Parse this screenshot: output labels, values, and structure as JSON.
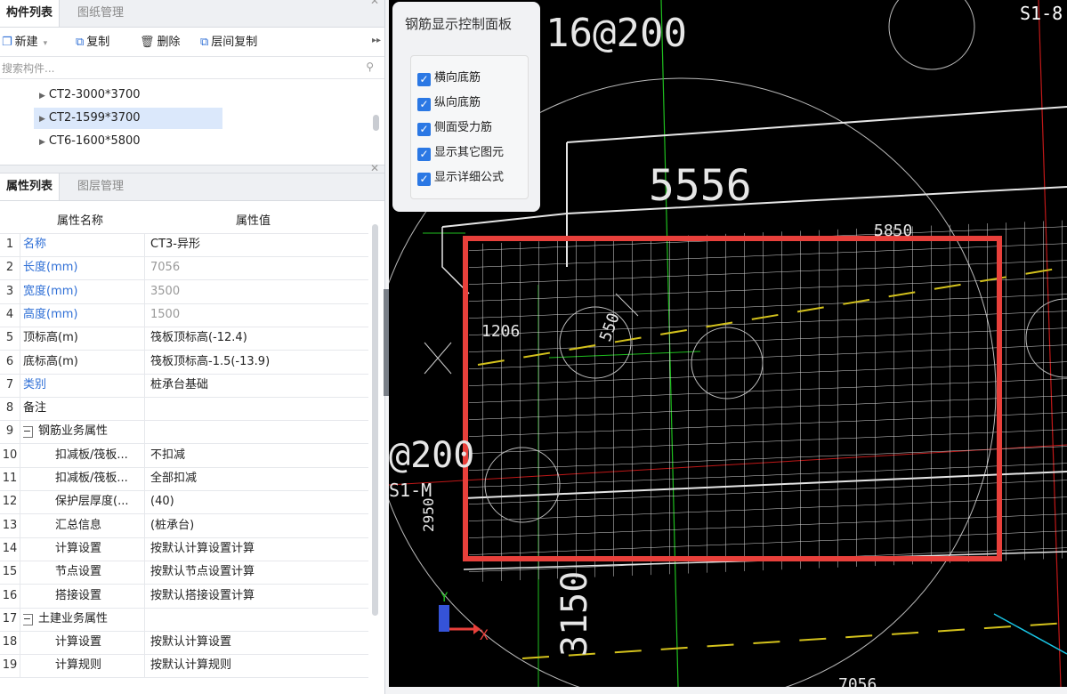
{
  "component_panel": {
    "tabs": [
      "构件列表",
      "图纸管理"
    ],
    "toolbar": {
      "new": "新建",
      "copy": "复制",
      "delete": "删除",
      "floor_copy": "层间复制"
    },
    "search_placeholder": "搜索构件...",
    "tree": [
      "CT2-3000*3700",
      "CT2-1599*3700",
      "CT6-1600*5800"
    ]
  },
  "property_panel": {
    "tabs": [
      "属性列表",
      "图层管理"
    ],
    "headers": {
      "name": "属性名称",
      "value": "属性值"
    },
    "rows": [
      {
        "n": "1",
        "name": "名称",
        "value": "CT3-异形"
      },
      {
        "n": "2",
        "name": "长度(mm)",
        "value": "7056"
      },
      {
        "n": "3",
        "name": "宽度(mm)",
        "value": "3500"
      },
      {
        "n": "4",
        "name": "高度(mm)",
        "value": "1500"
      },
      {
        "n": "5",
        "name": "顶标高(m)",
        "value": "筏板顶标高(-12.4)"
      },
      {
        "n": "6",
        "name": "底标高(m)",
        "value": "筏板顶标高-1.5(-13.9)"
      },
      {
        "n": "7",
        "name": "类别",
        "value": "桩承台基础"
      },
      {
        "n": "8",
        "name": "备注",
        "value": ""
      },
      {
        "n": "9",
        "name": "钢筋业务属性",
        "value": ""
      },
      {
        "n": "10",
        "name": "扣减板/筏板...",
        "value": "不扣减"
      },
      {
        "n": "11",
        "name": "扣减板/筏板...",
        "value": "全部扣减"
      },
      {
        "n": "12",
        "name": "保护层厚度(...",
        "value": "(40)"
      },
      {
        "n": "13",
        "name": "汇总信息",
        "value": "(桩承台)"
      },
      {
        "n": "14",
        "name": "计算设置",
        "value": "按默认计算设置计算"
      },
      {
        "n": "15",
        "name": "节点设置",
        "value": "按默认节点设置计算"
      },
      {
        "n": "16",
        "name": "搭接设置",
        "value": "按默认搭接设置计算"
      },
      {
        "n": "17",
        "name": "土建业务属性",
        "value": ""
      },
      {
        "n": "18",
        "name": "计算设置",
        "value": "按默认计算设置"
      },
      {
        "n": "19",
        "name": "计算规则",
        "value": "按默认计算规则"
      }
    ]
  },
  "rebar_panel": {
    "title": "钢筋显示控制面板",
    "options": [
      "横向底筋",
      "纵向底筋",
      "侧面受力筋",
      "显示其它图元",
      "显示详细公式"
    ]
  },
  "cad_labels": {
    "spacing": "16@200",
    "grid": "S1-8",
    "dim_5556": "5556",
    "dim_5850": "5850",
    "dim_1206": "1206",
    "dim_550": "550",
    "spacing_left": "@200",
    "grid_left": "S1-M",
    "dim_2950": "2950",
    "dim_3150": "3150",
    "dim_7056": "7056",
    "axis_y": "Y",
    "axis_x": "X"
  },
  "colors": {
    "highlight": "#e8403b",
    "accent": "#2f6fd6",
    "rebar": "#e0e0e0",
    "green_line": "#1fbf1f",
    "yellow_dash": "#d4c21c"
  }
}
